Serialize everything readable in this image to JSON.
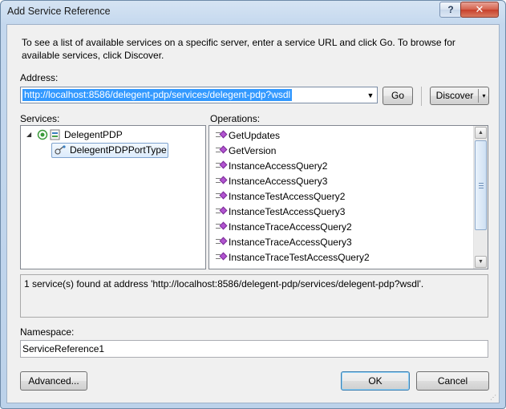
{
  "window": {
    "title": "Add Service Reference",
    "help_label": "?",
    "close_label": "✕"
  },
  "intro_text": "To see a list of available services on a specific server, enter a service URL and click Go. To browse for available services, click Discover.",
  "address": {
    "label": "Address:",
    "value": "http://localhost:8586/delegent-pdp/services/delegent-pdp?wsdl",
    "dropdown_arrow": "▼"
  },
  "go_button": "Go",
  "discover_button": {
    "label": "Discover",
    "arrow": "▾"
  },
  "services": {
    "label": "Services:",
    "tree": {
      "root": {
        "label": "DelegentPDP",
        "expanded": true
      },
      "child": {
        "label": "DelegentPDPPortType",
        "selected": true
      }
    }
  },
  "operations": {
    "label": "Operations:",
    "items": [
      "GetUpdates",
      "GetVersion",
      "InstanceAccessQuery2",
      "InstanceAccessQuery3",
      "InstanceTestAccessQuery2",
      "InstanceTestAccessQuery3",
      "InstanceTraceAccessQuery2",
      "InstanceTraceAccessQuery3",
      "InstanceTraceTestAccessQuery2"
    ]
  },
  "status_text": "1 service(s) found at address 'http://localhost:8586/delegent-pdp/services/delegent-pdp?wsdl'.",
  "namespace": {
    "label": "Namespace:",
    "value": "ServiceReference1"
  },
  "buttons": {
    "advanced": "Advanced...",
    "ok": "OK",
    "cancel": "Cancel"
  },
  "colors": {
    "selection": "#3399ff",
    "title_gradient_top": "#d6e4f3",
    "close_button": "#c7402b",
    "operation_icon": "#b254d1"
  }
}
